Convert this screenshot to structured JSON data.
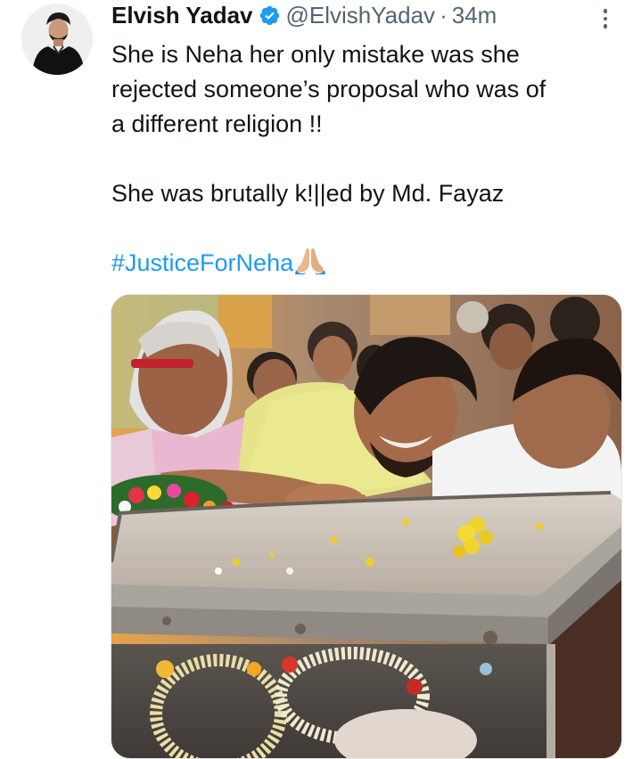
{
  "author": {
    "name": "Elvish Yadav",
    "handle": "@ElvishYadav",
    "separator": "·",
    "time": "34m",
    "verified": true,
    "avatar_icon": "profile-photo"
  },
  "tweet": {
    "lines": [
      "She is Neha her only mistake was she",
      "rejected someone’s proposal who was of",
      "a different religion !!"
    ],
    "line2": "She was brutally k!||ed by Md. Fayaz",
    "hashtag": "#JusticeForNeha",
    "emoji": "🙏🏼"
  },
  "media": {
    "type": "photo",
    "description_icon": "photo-attachment"
  },
  "colors": {
    "accent": "#1d9bf0",
    "text": "#0f1419",
    "secondary": "#536471"
  },
  "icons": {
    "verified": "verified-badge-icon",
    "more": "more-options-icon"
  }
}
